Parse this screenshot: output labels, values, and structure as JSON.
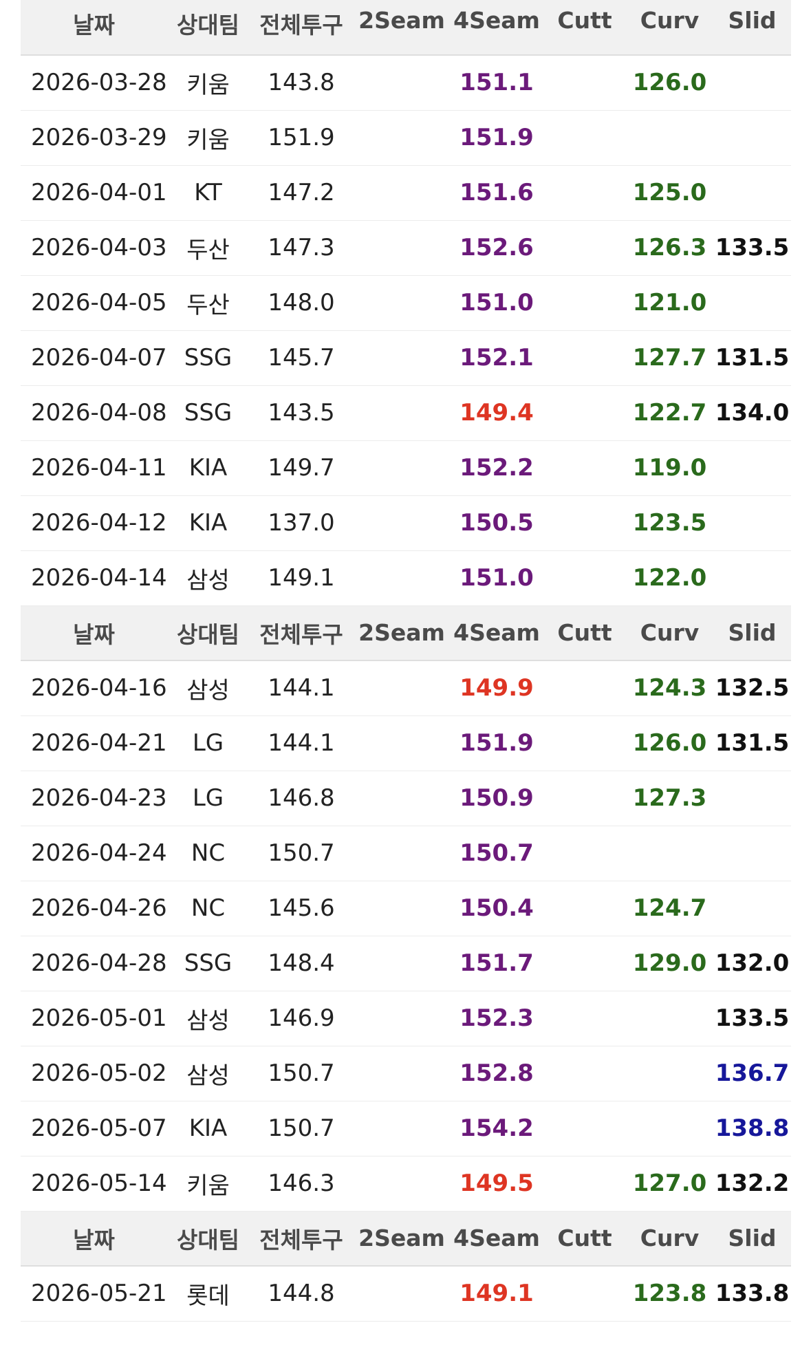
{
  "headers": [
    "날짜",
    "상대팀",
    "전체투구",
    "2Seam",
    "4Seam",
    "Cutt",
    "Curv",
    "Slid"
  ],
  "colors": {
    "purple": "#6b1a7a",
    "red": "#de3523",
    "green": "#2a6a1c",
    "black": "#111111",
    "blue": "#16179a"
  },
  "groups": [
    {
      "rows": [
        {
          "date": "2026-03-28",
          "team": "키움",
          "total": "143.8",
          "seam2": "",
          "seam4": "151.1",
          "seam4_color": "purple",
          "cutt": "",
          "curv": "126.0",
          "curv_color": "green",
          "slid": "",
          "slid_color": "black"
        },
        {
          "date": "2026-03-29",
          "team": "키움",
          "total": "151.9",
          "seam2": "",
          "seam4": "151.9",
          "seam4_color": "purple",
          "cutt": "",
          "curv": "",
          "curv_color": "green",
          "slid": "",
          "slid_color": "black"
        },
        {
          "date": "2026-04-01",
          "team": "KT",
          "total": "147.2",
          "seam2": "",
          "seam4": "151.6",
          "seam4_color": "purple",
          "cutt": "",
          "curv": "125.0",
          "curv_color": "green",
          "slid": "",
          "slid_color": "black"
        },
        {
          "date": "2026-04-03",
          "team": "두산",
          "total": "147.3",
          "seam2": "",
          "seam4": "152.6",
          "seam4_color": "purple",
          "cutt": "",
          "curv": "126.3",
          "curv_color": "green",
          "slid": "133.5",
          "slid_color": "black"
        },
        {
          "date": "2026-04-05",
          "team": "두산",
          "total": "148.0",
          "seam2": "",
          "seam4": "151.0",
          "seam4_color": "purple",
          "cutt": "",
          "curv": "121.0",
          "curv_color": "green",
          "slid": "",
          "slid_color": "black"
        },
        {
          "date": "2026-04-07",
          "team": "SSG",
          "total": "145.7",
          "seam2": "",
          "seam4": "152.1",
          "seam4_color": "purple",
          "cutt": "",
          "curv": "127.7",
          "curv_color": "green",
          "slid": "131.5",
          "slid_color": "black"
        },
        {
          "date": "2026-04-08",
          "team": "SSG",
          "total": "143.5",
          "seam2": "",
          "seam4": "149.4",
          "seam4_color": "red",
          "cutt": "",
          "curv": "122.7",
          "curv_color": "green",
          "slid": "134.0",
          "slid_color": "black"
        },
        {
          "date": "2026-04-11",
          "team": "KIA",
          "total": "149.7",
          "seam2": "",
          "seam4": "152.2",
          "seam4_color": "purple",
          "cutt": "",
          "curv": "119.0",
          "curv_color": "green",
          "slid": "",
          "slid_color": "black"
        },
        {
          "date": "2026-04-12",
          "team": "KIA",
          "total": "137.0",
          "seam2": "",
          "seam4": "150.5",
          "seam4_color": "purple",
          "cutt": "",
          "curv": "123.5",
          "curv_color": "green",
          "slid": "",
          "slid_color": "black"
        },
        {
          "date": "2026-04-14",
          "team": "삼성",
          "total": "149.1",
          "seam2": "",
          "seam4": "151.0",
          "seam4_color": "purple",
          "cutt": "",
          "curv": "122.0",
          "curv_color": "green",
          "slid": "",
          "slid_color": "black"
        }
      ]
    },
    {
      "rows": [
        {
          "date": "2026-04-16",
          "team": "삼성",
          "total": "144.1",
          "seam2": "",
          "seam4": "149.9",
          "seam4_color": "red",
          "cutt": "",
          "curv": "124.3",
          "curv_color": "green",
          "slid": "132.5",
          "slid_color": "black"
        },
        {
          "date": "2026-04-21",
          "team": "LG",
          "total": "144.1",
          "seam2": "",
          "seam4": "151.9",
          "seam4_color": "purple",
          "cutt": "",
          "curv": "126.0",
          "curv_color": "green",
          "slid": "131.5",
          "slid_color": "black"
        },
        {
          "date": "2026-04-23",
          "team": "LG",
          "total": "146.8",
          "seam2": "",
          "seam4": "150.9",
          "seam4_color": "purple",
          "cutt": "",
          "curv": "127.3",
          "curv_color": "green",
          "slid": "",
          "slid_color": "black"
        },
        {
          "date": "2026-04-24",
          "team": "NC",
          "total": "150.7",
          "seam2": "",
          "seam4": "150.7",
          "seam4_color": "purple",
          "cutt": "",
          "curv": "",
          "curv_color": "green",
          "slid": "",
          "slid_color": "black"
        },
        {
          "date": "2026-04-26",
          "team": "NC",
          "total": "145.6",
          "seam2": "",
          "seam4": "150.4",
          "seam4_color": "purple",
          "cutt": "",
          "curv": "124.7",
          "curv_color": "green",
          "slid": "",
          "slid_color": "black"
        },
        {
          "date": "2026-04-28",
          "team": "SSG",
          "total": "148.4",
          "seam2": "",
          "seam4": "151.7",
          "seam4_color": "purple",
          "cutt": "",
          "curv": "129.0",
          "curv_color": "green",
          "slid": "132.0",
          "slid_color": "black"
        },
        {
          "date": "2026-05-01",
          "team": "삼성",
          "total": "146.9",
          "seam2": "",
          "seam4": "152.3",
          "seam4_color": "purple",
          "cutt": "",
          "curv": "",
          "curv_color": "green",
          "slid": "133.5",
          "slid_color": "black"
        },
        {
          "date": "2026-05-02",
          "team": "삼성",
          "total": "150.7",
          "seam2": "",
          "seam4": "152.8",
          "seam4_color": "purple",
          "cutt": "",
          "curv": "",
          "curv_color": "green",
          "slid": "136.7",
          "slid_color": "blue"
        },
        {
          "date": "2026-05-07",
          "team": "KIA",
          "total": "150.7",
          "seam2": "",
          "seam4": "154.2",
          "seam4_color": "purple",
          "cutt": "",
          "curv": "",
          "curv_color": "green",
          "slid": "138.8",
          "slid_color": "blue"
        },
        {
          "date": "2026-05-14",
          "team": "키움",
          "total": "146.3",
          "seam2": "",
          "seam4": "149.5",
          "seam4_color": "red",
          "cutt": "",
          "curv": "127.0",
          "curv_color": "green",
          "slid": "132.2",
          "slid_color": "black"
        }
      ]
    },
    {
      "rows": [
        {
          "date": "2026-05-21",
          "team": "롯데",
          "total": "144.8",
          "seam2": "",
          "seam4": "149.1",
          "seam4_color": "red",
          "cutt": "",
          "curv": "123.8",
          "curv_color": "green",
          "slid": "133.8",
          "slid_color": "black"
        }
      ]
    }
  ]
}
